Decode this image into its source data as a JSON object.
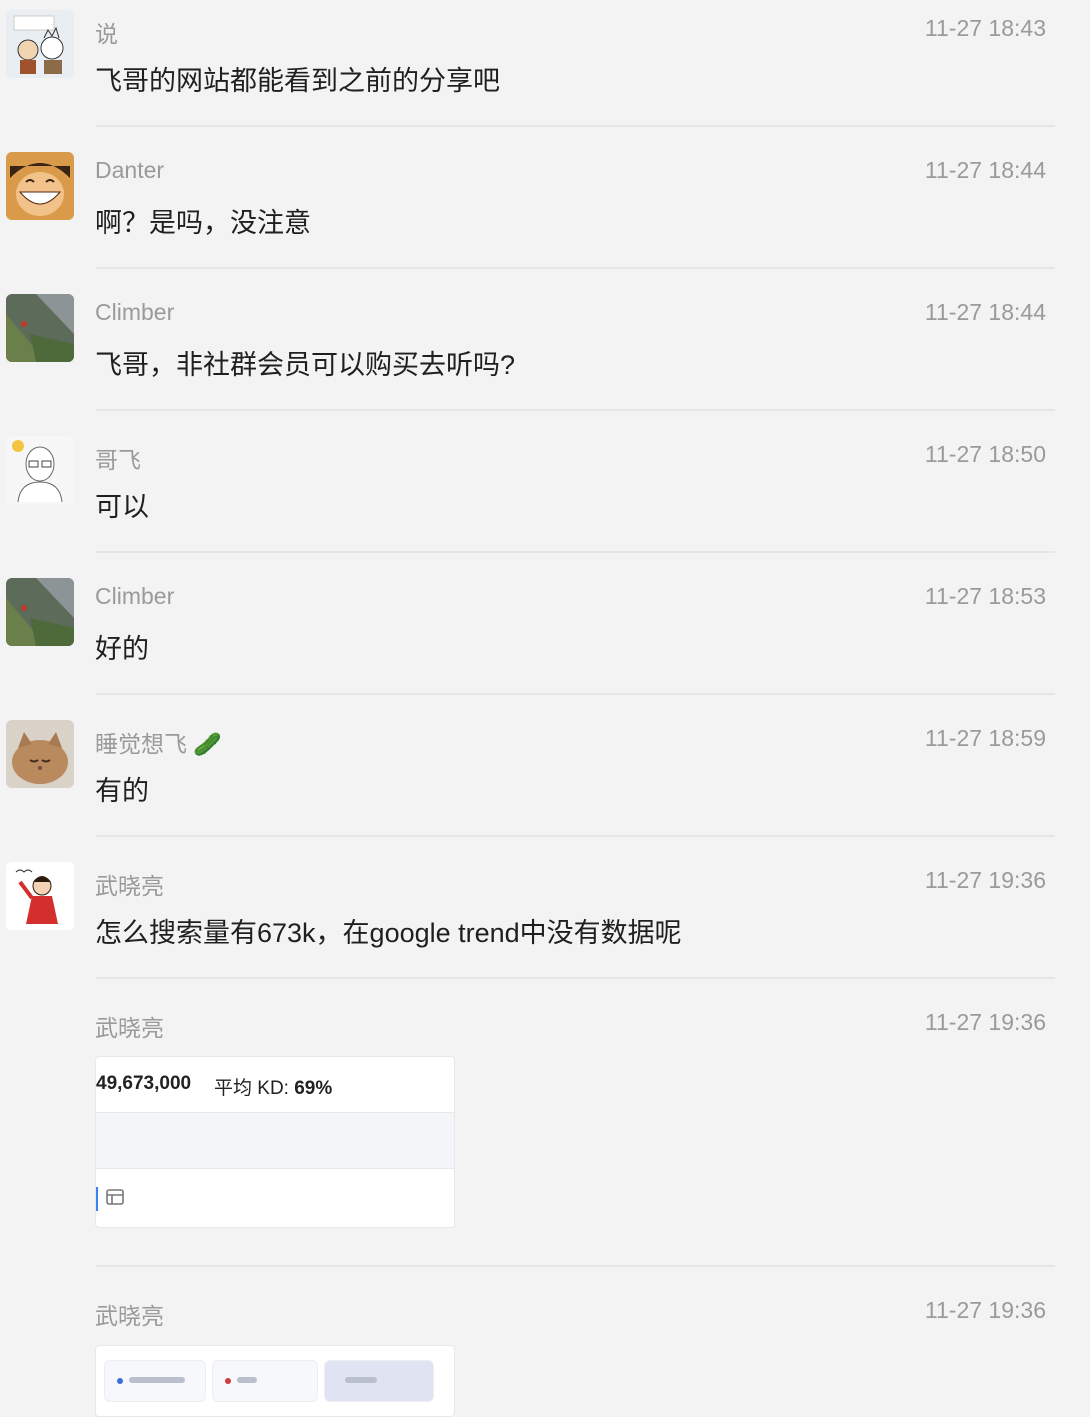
{
  "messages": [
    {
      "sender": "说",
      "time": "11-27 18:43",
      "text": "飞哥的网站都能看到之前的分享吧",
      "avatar_icon": "cartoon-avatar-icon"
    },
    {
      "sender": "Danter",
      "time": "11-27 18:44",
      "text": "啊？是吗，没注意",
      "avatar_icon": "anime-face-avatar-icon"
    },
    {
      "sender": "Climber",
      "time": "11-27 18:44",
      "text": "飞哥，非社群会员可以购买去听吗?",
      "avatar_icon": "cliff-photo-avatar-icon"
    },
    {
      "sender": "哥飞",
      "time": "11-27 18:50",
      "text": "可以",
      "avatar_icon": "glasses-man-avatar-icon"
    },
    {
      "sender": "Climber",
      "time": "11-27 18:53",
      "text": "好的",
      "avatar_icon": "cliff-photo-avatar-icon"
    },
    {
      "sender": "睡觉想飞",
      "time": "11-27 18:59",
      "text": "有的",
      "avatar_icon": "cat-avatar-icon",
      "sender_emoji": "🥒"
    },
    {
      "sender": "武晓亮",
      "time": "11-27 19:36",
      "text": "怎么搜索量有673k，在google trend中没有数据呢",
      "avatar_icon": "red-dress-girl-avatar-icon"
    }
  ],
  "image_message_1": {
    "sender": "武晓亮",
    "time": "11-27 19:36",
    "volume": "49,673,000",
    "kd_label": "平均 KD:",
    "kd_value": "69%"
  },
  "image_message_2": {
    "sender": "武晓亮",
    "time": "11-27 19:36"
  },
  "colors": {
    "background": "#f3f3f3",
    "meta_text": "#9a9a9a",
    "body_text": "#1f1f1f",
    "divider": "#e6e6e6"
  }
}
